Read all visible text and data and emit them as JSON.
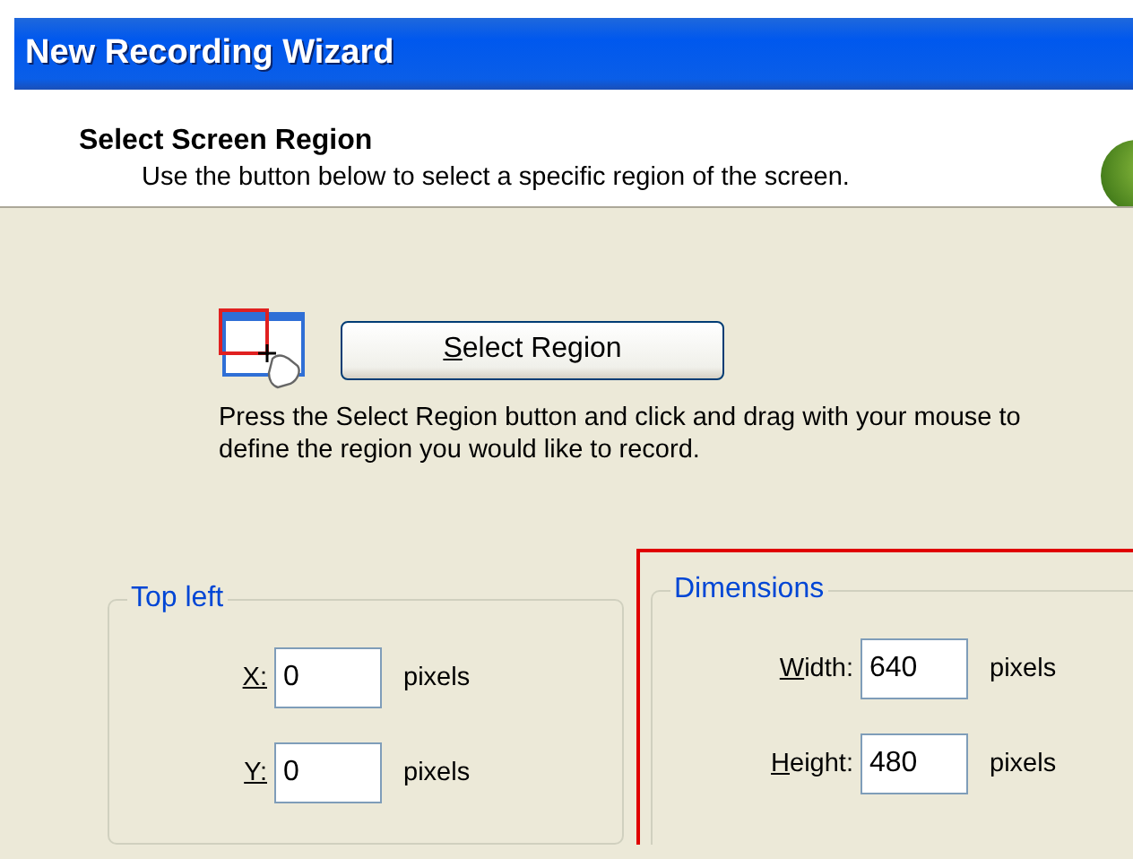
{
  "window": {
    "title": "New Recording Wizard"
  },
  "header": {
    "title": "Select Screen Region",
    "subtitle": "Use the button below to select a specific region of the screen."
  },
  "select_button": {
    "label": "Select Region"
  },
  "instructions": "Press the Select Region button and click and drag with your mouse to define the region you would like to record.",
  "groups": [
    {
      "title": "Top left",
      "highlighted": false,
      "fields": [
        {
          "label": "X:",
          "value": "0",
          "unit": "pixels"
        },
        {
          "label": "Y:",
          "value": "0",
          "unit": "pixels"
        }
      ]
    },
    {
      "title": "Dimensions",
      "highlighted": true,
      "fields": [
        {
          "label": "Width:",
          "value": "640",
          "unit": "pixels"
        },
        {
          "label": "Height:",
          "value": "480",
          "unit": "pixels"
        }
      ]
    }
  ]
}
